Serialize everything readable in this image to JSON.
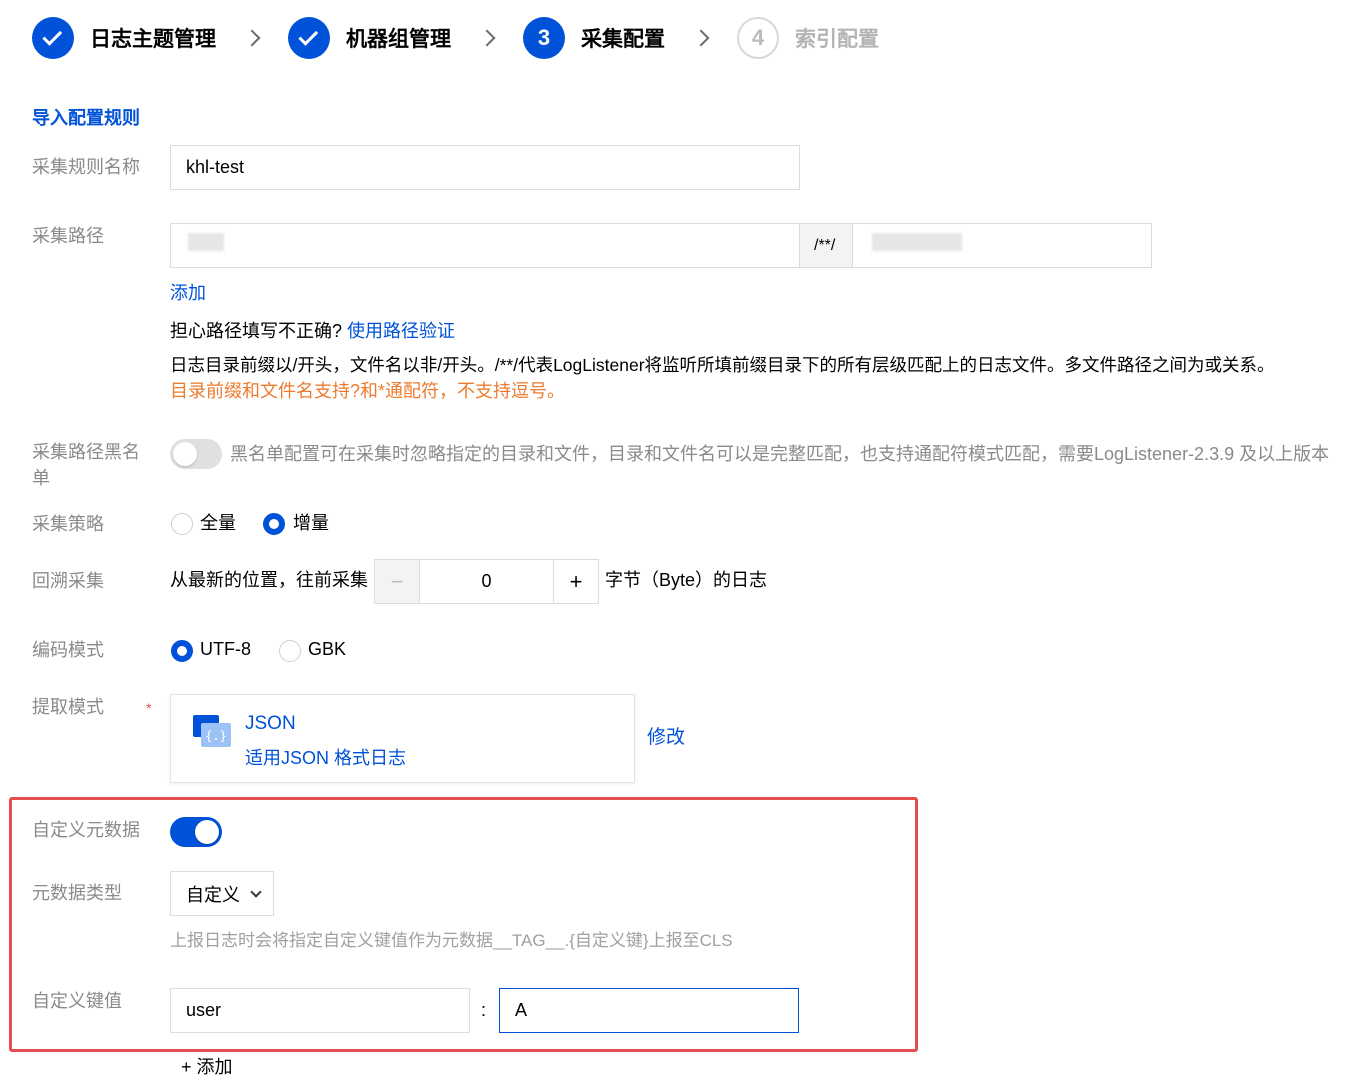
{
  "steps": [
    {
      "num": "✓",
      "label": "日志主题管理",
      "state": "done"
    },
    {
      "num": "✓",
      "label": "机器组管理",
      "state": "done"
    },
    {
      "num": "3",
      "label": "采集配置",
      "state": "active"
    },
    {
      "num": "4",
      "label": "索引配置",
      "state": "pending"
    }
  ],
  "import_rules": "导入配置规则",
  "rule_name": {
    "label": "采集规则名称",
    "value": "khl-test"
  },
  "path": {
    "label": "采集路径",
    "separator": "/**/",
    "add": "添加",
    "verify_prompt": "担心路径填写不正确?",
    "verify_link": "使用路径验证",
    "hint": "日志目录前缀以/开头，文件名以非/开头。/**/代表LogListener将监听所填前缀目录下的所有层级匹配上的日志文件。多文件路径之间为或关系。",
    "warning": "目录前缀和文件名支持?和*通配符，不支持逗号。"
  },
  "blacklist": {
    "label_line1": "采集路径黑名",
    "label_line2": "单",
    "desc": "黑名单配置可在采集时忽略指定的目录和文件，目录和文件名可以是完整匹配，也支持通配符模式匹配，需要LogListener-2.3.9 及以上版本"
  },
  "strategy": {
    "label": "采集策略",
    "options": [
      "全量",
      "增量"
    ],
    "selected": "增量"
  },
  "backtrack": {
    "label": "回溯采集",
    "prefix": "从最新的位置，往前采集",
    "minus": "−",
    "value": "0",
    "plus": "+",
    "suffix": "字节（Byte）的日志"
  },
  "encoding": {
    "label": "编码模式",
    "options": [
      "UTF-8",
      "GBK"
    ],
    "selected": "UTF-8"
  },
  "extract": {
    "label": "提取模式",
    "required": "*",
    "title": "JSON",
    "desc": "适用JSON 格式日志",
    "modify": "修改"
  },
  "custom_meta": {
    "label": "自定义元数据",
    "enabled": true
  },
  "meta_type": {
    "label": "元数据类型",
    "value": "自定义",
    "hint": "上报日志时会将指定自定义键值作为元数据__TAG__.{自定义键}上报至CLS"
  },
  "custom_kv": {
    "label": "自定义键值",
    "key": "user",
    "colon": ":",
    "value": "A",
    "add": "+ 添加"
  },
  "colors": {
    "primary": "#0052d9",
    "warning": "#ed7b2f",
    "highlight": "#e34d4d"
  }
}
